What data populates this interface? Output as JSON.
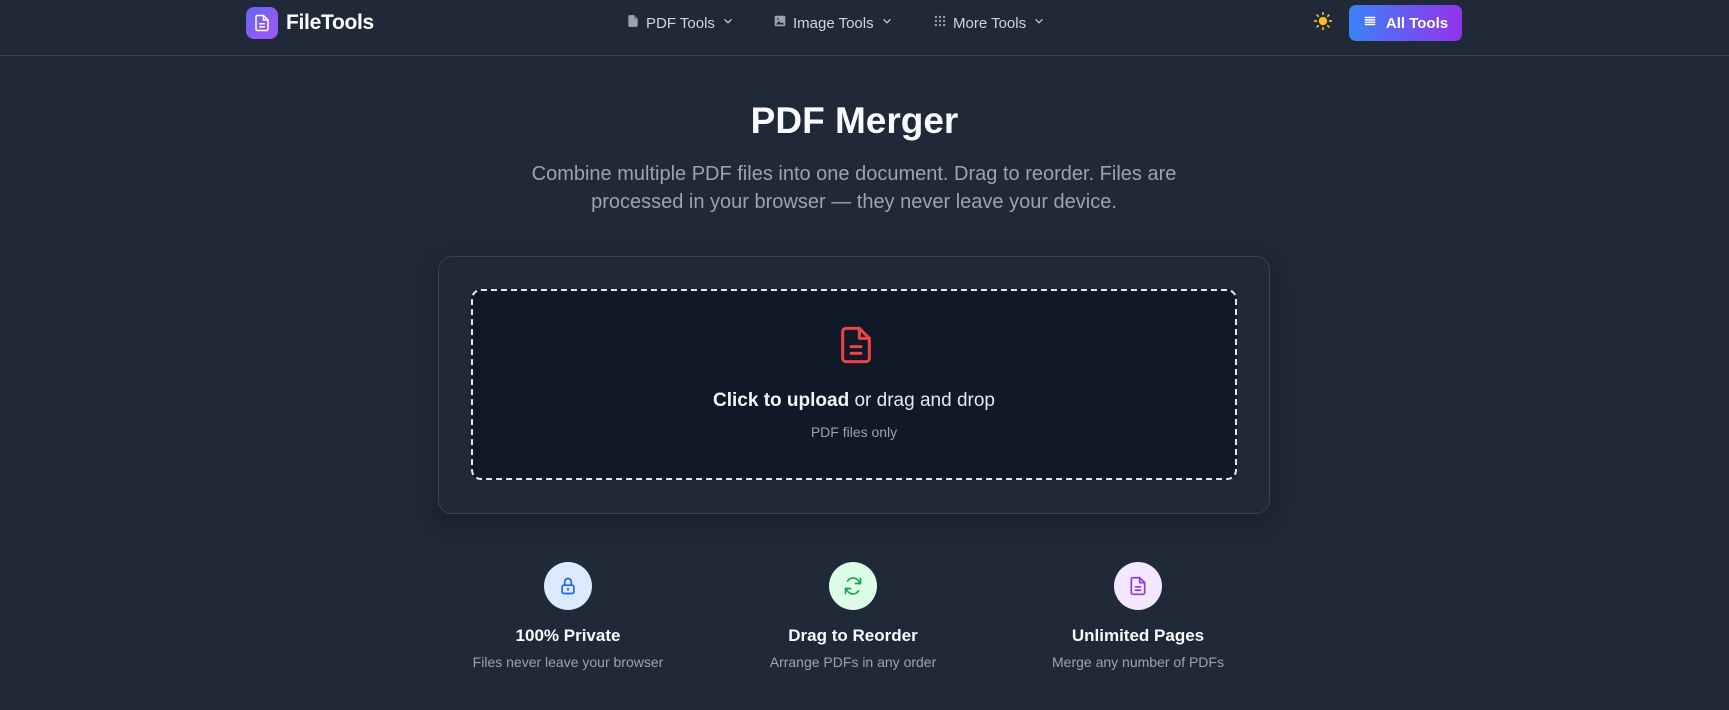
{
  "header": {
    "brand": "FileTools",
    "nav": [
      {
        "label": "PDF Tools",
        "icon": "file-icon"
      },
      {
        "label": "Image Tools",
        "icon": "image-icon"
      },
      {
        "label": "More Tools",
        "icon": "grid-icon"
      }
    ],
    "theme_icon": "sun-icon",
    "all_tools_label": "All Tools"
  },
  "main": {
    "title": "PDF Merger",
    "subtitle": "Combine multiple PDF files into one document. Drag to reorder. Files are processed in your browser — they never leave your device."
  },
  "upload": {
    "strong": "Click to upload",
    "rest": " or drag and drop",
    "hint": "PDF files only"
  },
  "features": [
    {
      "title": "100% Private",
      "desc": "Files never leave your browser",
      "icon": "lock-icon"
    },
    {
      "title": "Drag to Reorder",
      "desc": "Arrange PDFs in any order",
      "icon": "refresh-icon"
    },
    {
      "title": "Unlimited Pages",
      "desc": "Merge any number of PDFs",
      "icon": "document-icon"
    }
  ],
  "colors": {
    "background": "#1f2937",
    "accent_from": "#3b82f6",
    "accent_to": "#9333ea",
    "pdf_red": "#ef4444",
    "sun_yellow": "#fbbf24"
  }
}
